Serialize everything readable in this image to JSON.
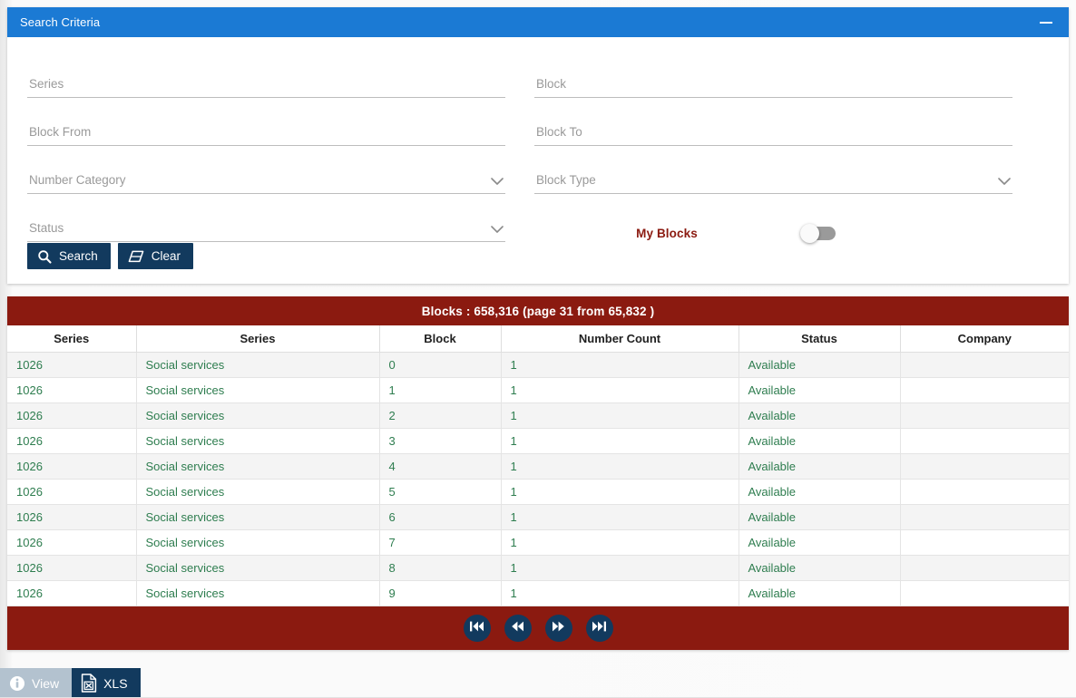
{
  "panel": {
    "title": "Search Criteria",
    "minimize_icon": "minimize-icon"
  },
  "form": {
    "left_fields": [
      {
        "label": "Series",
        "value": "",
        "type": "text",
        "name": "series"
      },
      {
        "label": "Block From",
        "value": "",
        "type": "text",
        "name": "block-from"
      },
      {
        "label": "Number Category",
        "value": "",
        "type": "select",
        "name": "number-category"
      },
      {
        "label": "Status",
        "value": "",
        "type": "select",
        "name": "status"
      }
    ],
    "right_fields": [
      {
        "label": "Block",
        "value": "",
        "type": "text",
        "name": "block"
      },
      {
        "label": "Block To",
        "value": "",
        "type": "text",
        "name": "block-to"
      },
      {
        "label": "Block Type",
        "value": "",
        "type": "select",
        "name": "block-type"
      }
    ],
    "toggle": {
      "label": "My Blocks",
      "state": "off"
    },
    "buttons": {
      "search": "Search",
      "clear": "Clear",
      "search_icon": "search-icon",
      "clear_icon": "eraser-icon"
    }
  },
  "results": {
    "summary": "Blocks : 658,316 (page 31 from 65,832 )",
    "total": "658,316",
    "page": "31",
    "page_count": "65,832",
    "columns": [
      "Series",
      "Series",
      "Block",
      "Number Count",
      "Status",
      "Company"
    ],
    "rows": [
      [
        "1026",
        "Social services",
        "0",
        "1",
        "Available",
        ""
      ],
      [
        "1026",
        "Social services",
        "1",
        "1",
        "Available",
        ""
      ],
      [
        "1026",
        "Social services",
        "2",
        "1",
        "Available",
        ""
      ],
      [
        "1026",
        "Social services",
        "3",
        "1",
        "Available",
        ""
      ],
      [
        "1026",
        "Social services",
        "4",
        "1",
        "Available",
        ""
      ],
      [
        "1026",
        "Social services",
        "5",
        "1",
        "Available",
        ""
      ],
      [
        "1026",
        "Social services",
        "6",
        "1",
        "Available",
        ""
      ],
      [
        "1026",
        "Social services",
        "7",
        "1",
        "Available",
        ""
      ],
      [
        "1026",
        "Social services",
        "8",
        "1",
        "Available",
        ""
      ],
      [
        "1026",
        "Social services",
        "9",
        "1",
        "Available",
        ""
      ]
    ],
    "pager": [
      {
        "name": "first-page-button",
        "icon": "skip-backward-icon"
      },
      {
        "name": "previous-page-button",
        "icon": "rewind-icon"
      },
      {
        "name": "next-page-button",
        "icon": "fast-forward-icon"
      },
      {
        "name": "last-page-button",
        "icon": "skip-forward-icon"
      }
    ]
  },
  "bottom_bar": {
    "view_label": "View",
    "view_icon": "info-icon",
    "xls_label": "XLS",
    "xls_icon": "excel-file-icon"
  },
  "colors": {
    "header_blue": "#1b7ad4",
    "maroon": "#8b1a10",
    "navy": "#123a5e",
    "cell_green": "#2e7d4f",
    "toggle_off": "#9a9a9a",
    "view_disabled": "#b3c2cf"
  }
}
